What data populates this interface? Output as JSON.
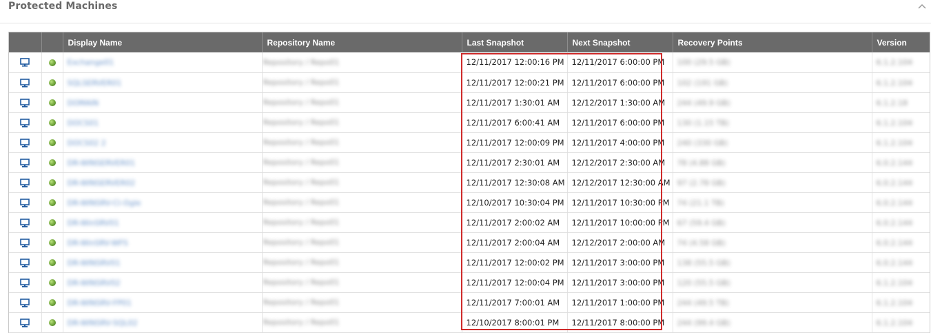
{
  "panel": {
    "title": "Protected Machines"
  },
  "table": {
    "headers": [
      "",
      "",
      "Display Name",
      "Repository Name",
      "Last Snapshot",
      "Next Snapshot",
      "Recovery Points",
      "Version"
    ],
    "rows": [
      {
        "display_name": "Exchange01",
        "repository": "Repository / Repo01",
        "last_snapshot": "12/11/2017 12:00:16 PM",
        "next_snapshot": "12/11/2017 6:00:00 PM",
        "recovery_points": "100 (29.5 GB)",
        "version": "6.1.2.104"
      },
      {
        "display_name": "SQLSERVER01",
        "repository": "Repository / Repo01",
        "last_snapshot": "12/11/2017 12:00:21 PM",
        "next_snapshot": "12/11/2017 6:00:00 PM",
        "recovery_points": "102 (191 GB)",
        "version": "6.1.2.104"
      },
      {
        "display_name": "DOMAIN",
        "repository": "Repository / Repo01",
        "last_snapshot": "12/11/2017 1:30:01 AM",
        "next_snapshot": "12/12/2017 1:30:00 AM",
        "recovery_points": "244 (49.9 GB)",
        "version": "6.1.2.18"
      },
      {
        "display_name": "DOCS01",
        "repository": "Repository / Repo01",
        "last_snapshot": "12/11/2017 6:00:41 AM",
        "next_snapshot": "12/11/2017 6:00:00 PM",
        "recovery_points": "130 (1.15 TB)",
        "version": "6.1.2.104"
      },
      {
        "display_name": "DOCS02 2",
        "repository": "Repository / Repo01",
        "last_snapshot": "12/11/2017 12:00:09 PM",
        "next_snapshot": "12/11/2017 4:00:00 PM",
        "recovery_points": "240 (330 GB)",
        "version": "6.1.2.104"
      },
      {
        "display_name": "DR-WINSERVER01",
        "repository": "Repository / Repo01",
        "last_snapshot": "12/11/2017 2:30:01 AM",
        "next_snapshot": "12/12/2017 2:30:00 AM",
        "recovery_points": "78 (4.88 GB)",
        "version": "6.0.2.144"
      },
      {
        "display_name": "DR-WINSERVER02",
        "repository": "Repository / Repo01",
        "last_snapshot": "12/11/2017 12:30:08 AM",
        "next_snapshot": "12/12/2017 12:30:00 AM",
        "recovery_points": "97 (2.78 GB)",
        "version": "6.0.2.144"
      },
      {
        "display_name": "DR-WINSRV-Cl-Ogle",
        "repository": "Repository / Repo01",
        "last_snapshot": "12/10/2017 10:30:04 PM",
        "next_snapshot": "12/11/2017 10:30:00 PM",
        "recovery_points": "74 (21.1 TB)",
        "version": "6.0.2.144"
      },
      {
        "display_name": "DR-WinSRV01",
        "repository": "Repository / Repo01",
        "last_snapshot": "12/11/2017 2:00:02 AM",
        "next_snapshot": "12/11/2017 10:00:00 PM",
        "recovery_points": "67 (59.4 GB)",
        "version": "6.0.2.144"
      },
      {
        "display_name": "DR-WinSRV-WFS",
        "repository": "Repository / Repo01",
        "last_snapshot": "12/11/2017 2:00:04 AM",
        "next_snapshot": "12/12/2017 2:00:00 AM",
        "recovery_points": "74 (4.58 GB)",
        "version": "6.0.2.144"
      },
      {
        "display_name": "DR-WINSRV01",
        "repository": "Repository / Repo01",
        "last_snapshot": "12/11/2017 12:00:02 PM",
        "next_snapshot": "12/11/2017 3:00:00 PM",
        "recovery_points": "138 (55.5 GB)",
        "version": "6.0.2.144"
      },
      {
        "display_name": "DR-WINSRV02",
        "repository": "Repository / Repo01",
        "last_snapshot": "12/11/2017 12:00:04 PM",
        "next_snapshot": "12/11/2017 3:00:00 PM",
        "recovery_points": "120 (55.5 GB)",
        "version": "6.1.2.104"
      },
      {
        "display_name": "DR-WINSRV-FP01",
        "repository": "Repository / Repo01",
        "last_snapshot": "12/11/2017 7:00:01 AM",
        "next_snapshot": "12/11/2017 1:00:00 PM",
        "recovery_points": "244 (49.5 TB)",
        "version": "6.1.2.104"
      },
      {
        "display_name": "DR-WINSRV-SQL02",
        "repository": "Repository / Repo01",
        "last_snapshot": "12/10/2017 8:00:01 PM",
        "next_snapshot": "12/11/2017 8:00:00 PM",
        "recovery_points": "244 (99.4 GB)",
        "version": "6.1.2.104"
      }
    ]
  },
  "colors": {
    "header_bg": "#6a6a6a",
    "highlight_box": "#cf2b2b",
    "status_ok": "#6ea33a",
    "machine_icon": "#1f5aa0"
  },
  "icons": {
    "machine": "monitor-icon",
    "status": "status-online-icon",
    "repository": "repository-icon",
    "collapse": "chevron-up-icon"
  }
}
